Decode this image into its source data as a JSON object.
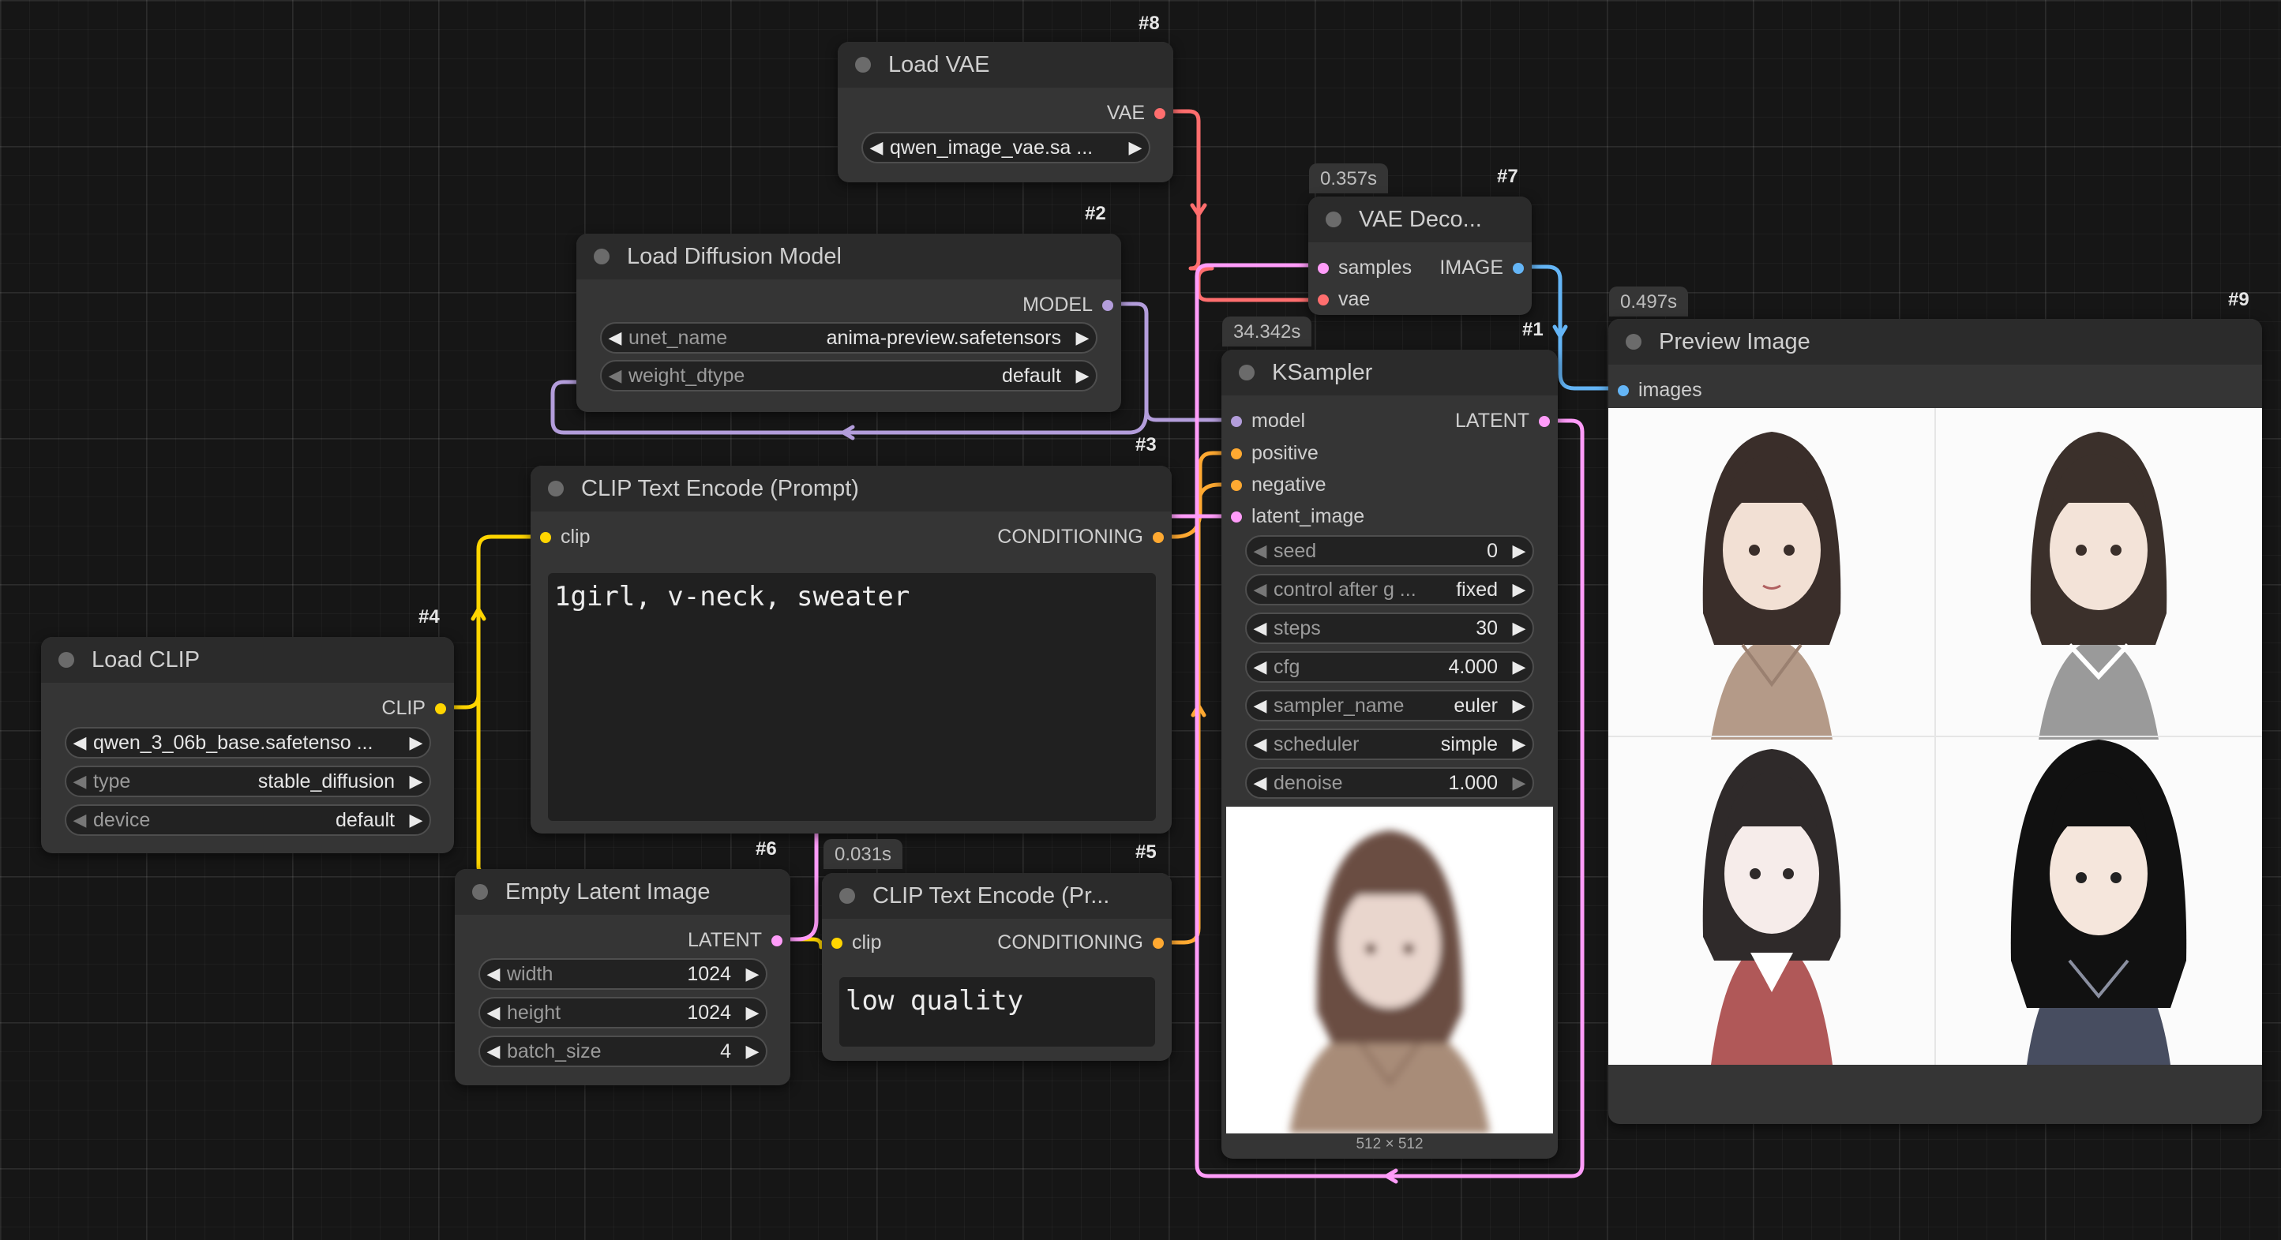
{
  "colors": {
    "model": "#b39ddb",
    "clip": "#ffd500",
    "conditioning": "#ffa931",
    "latent": "#ff9cf9",
    "vae": "#ff6e6e",
    "image": "#64b5f6"
  },
  "nodes": {
    "load_vae": {
      "id": "#8",
      "title": "Load VAE",
      "out": "VAE",
      "w_value": "qwen_image_vae.sa ..."
    },
    "load_diffusion": {
      "id": "#2",
      "title": "Load Diffusion Model",
      "out": "MODEL",
      "unet_label": "unet_name",
      "unet_value": "anima-preview.safetensors",
      "dtype_label": "weight_dtype",
      "dtype_value": "default"
    },
    "vae_decode": {
      "id": "#7",
      "timing": "0.357s",
      "title": "VAE Deco...",
      "in1": "samples",
      "in2": "vae",
      "out": "IMAGE"
    },
    "preview": {
      "id": "#9",
      "timing": "0.497s",
      "title": "Preview Image",
      "in": "images"
    },
    "ksampler": {
      "id": "#1",
      "timing": "34.342s",
      "title": "KSampler",
      "in_model": "model",
      "in_positive": "positive",
      "in_negative": "negative",
      "in_latent": "latent_image",
      "out": "LATENT",
      "widgets": [
        {
          "label": "seed",
          "value": "0"
        },
        {
          "label": "control after g ...",
          "value": "fixed"
        },
        {
          "label": "steps",
          "value": "30"
        },
        {
          "label": "cfg",
          "value": "4.000"
        },
        {
          "label": "sampler_name",
          "value": "euler"
        },
        {
          "label": "scheduler",
          "value": "simple"
        },
        {
          "label": "denoise",
          "value": "1.000"
        }
      ],
      "image_size": "512 × 512"
    },
    "clip_pos": {
      "id": "#3",
      "title": "CLIP Text Encode (Prompt)",
      "in": "clip",
      "out": "CONDITIONING",
      "text": "1girl, v-neck, sweater"
    },
    "load_clip": {
      "id": "#4",
      "title": "Load CLIP",
      "out": "CLIP",
      "clip_value": "qwen_3_06b_base.safetenso ...",
      "type_label": "type",
      "type_value": "stable_diffusion",
      "device_label": "device",
      "device_value": "default"
    },
    "empty_latent": {
      "id": "#6",
      "title": "Empty Latent Image",
      "out": "LATENT",
      "widgets": [
        {
          "label": "width",
          "value": "1024"
        },
        {
          "label": "height",
          "value": "1024"
        },
        {
          "label": "batch_size",
          "value": "4"
        }
      ]
    },
    "clip_neg": {
      "id": "#5",
      "timing": "0.031s",
      "title": "CLIP Text Encode (Pr...",
      "in": "clip",
      "out": "CONDITIONING",
      "text": "low quality"
    }
  }
}
